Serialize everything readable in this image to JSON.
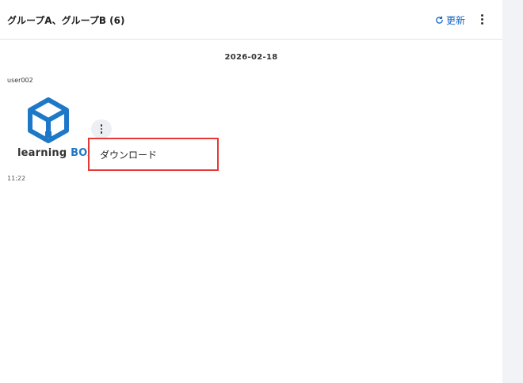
{
  "header": {
    "title": "グループA、グループB (6)",
    "refresh_label": "更新"
  },
  "message": {
    "date": "2026-02-18",
    "user": "user002",
    "time": "11:22",
    "image": {
      "logo_word_main": "learning",
      "logo_word_accent": "BOX"
    },
    "menu": {
      "items": [
        "ダウンロード"
      ]
    }
  },
  "colors": {
    "accent": "#1565c0",
    "highlight_border": "#e53935",
    "logo_blue": "#1e78c8",
    "side_panel": "#f1f3f6"
  },
  "icons": {
    "refresh": "refresh-icon",
    "more_header": "more-vertical-icon",
    "more_message": "more-vertical-icon"
  }
}
